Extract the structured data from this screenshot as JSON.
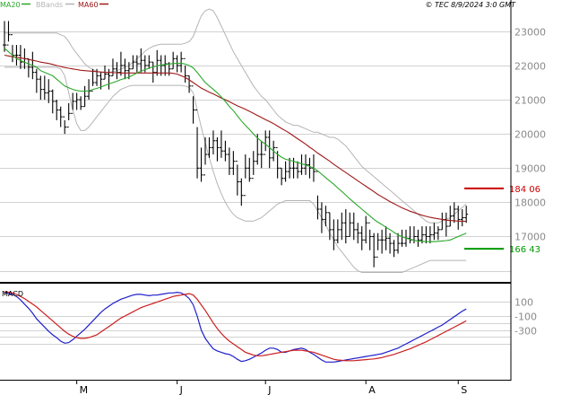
{
  "header": {
    "legend": [
      {
        "label": "MA20",
        "color": "#2aa82a"
      },
      {
        "label": "BBands",
        "color": "#b4b4b4"
      },
      {
        "label": "MA60",
        "color": "#a01818"
      }
    ],
    "copyright": "© TEC 8/9/2024 3:0 GMT"
  },
  "chart_data": [
    {
      "type": "ohlc",
      "panel": "price",
      "y_ticks": [
        23000,
        22000,
        21000,
        20000,
        19000,
        18000,
        17000
      ],
      "y_tick_labels": [
        "23000",
        "22000",
        "21000",
        "20000",
        "19000",
        "18000",
        "17000"
      ],
      "ylim": [
        15700,
        23600
      ],
      "x_count": 116,
      "x_tick_labels": [
        {
          "label": "M",
          "index": 18
        },
        {
          "label": "J",
          "index": 43
        },
        {
          "label": "J",
          "index": 65
        },
        {
          "label": "A",
          "index": 90
        },
        {
          "label": "S",
          "index": 113
        }
      ],
      "close": [
        22600,
        22900,
        22300,
        22300,
        22100,
        22200,
        21950,
        21800,
        21600,
        21300,
        21200,
        21250,
        20950,
        20700,
        20500,
        20200,
        20600,
        20950,
        21000,
        20800,
        21100,
        21250,
        21500,
        21700,
        21600,
        21750,
        21700,
        21900,
        21800,
        22000,
        21850,
        21900,
        22100,
        22050,
        22150,
        22000,
        22100,
        21800,
        22150,
        22000,
        22050,
        21900,
        22200,
        22000,
        22200,
        21700,
        21400,
        20700,
        19000,
        18800,
        19400,
        19600,
        19800,
        19600,
        19500,
        19400,
        19000,
        19200,
        18600,
        18200,
        19000,
        18700,
        19200,
        19400,
        19400,
        19900,
        19300,
        19600,
        19000,
        18700,
        18900,
        19000,
        19000,
        18900,
        19000,
        19100,
        19000,
        18900,
        17800,
        17500,
        17700,
        17200,
        16900,
        17200,
        17400,
        17000,
        17400,
        17200,
        17100,
        16900,
        17400,
        17000,
        16400,
        16900,
        16900,
        16950,
        16800,
        16600,
        16800,
        16800,
        16950,
        16900,
        17000,
        16900,
        17050,
        17000,
        17050,
        17100,
        17200,
        17500,
        17300,
        17600,
        17800,
        17500,
        17550,
        17650
      ],
      "high": [
        23300,
        23300,
        22600,
        22600,
        22600,
        22500,
        22200,
        22400,
        21900,
        21700,
        21700,
        21600,
        21300,
        21000,
        20800,
        20400,
        20900,
        21200,
        21200,
        21100,
        21400,
        21600,
        21900,
        21900,
        21800,
        22000,
        21900,
        22200,
        22100,
        22400,
        22200,
        22100,
        22300,
        22300,
        22500,
        22300,
        22300,
        22100,
        22450,
        22300,
        22300,
        22100,
        22400,
        22300,
        22400,
        22000,
        21700,
        21100,
        20200,
        19600,
        19900,
        19900,
        20100,
        19900,
        20100,
        19800,
        19600,
        19500,
        19100,
        18700,
        19400,
        19300,
        19500,
        20000,
        19800,
        20100,
        20100,
        19800,
        19500,
        19000,
        19200,
        19300,
        19300,
        19200,
        19400,
        19400,
        19300,
        19400,
        18200,
        18000,
        17900,
        17700,
        17500,
        17500,
        17700,
        17800,
        17700,
        17700,
        17400,
        17300,
        17600,
        17200,
        17100,
        17100,
        17200,
        17300,
        17100,
        16900,
        17100,
        17200,
        17200,
        17300,
        17300,
        17200,
        17300,
        17300,
        17300,
        17400,
        17300,
        17700,
        17700,
        17900,
        18000,
        17900,
        17800,
        17900
      ],
      "low": [
        22400,
        22700,
        22100,
        22000,
        21900,
        21900,
        21650,
        21600,
        21200,
        21000,
        21000,
        20900,
        20600,
        20400,
        20200,
        20000,
        20400,
        20700,
        20700,
        20700,
        20800,
        21000,
        21400,
        21400,
        21300,
        21600,
        21300,
        21700,
        21600,
        21700,
        21600,
        21600,
        21900,
        21800,
        21800,
        21800,
        21900,
        21500,
        21700,
        21700,
        21700,
        21700,
        21900,
        21800,
        21800,
        21500,
        21200,
        20300,
        18700,
        18600,
        19100,
        19300,
        19400,
        19200,
        19300,
        19200,
        18800,
        18800,
        18200,
        17900,
        18700,
        18600,
        18800,
        19100,
        19000,
        19500,
        19000,
        19200,
        18700,
        18500,
        18600,
        18700,
        18700,
        18700,
        18800,
        18800,
        18700,
        18600,
        17500,
        17100,
        17300,
        16900,
        16600,
        16800,
        16900,
        16800,
        17000,
        16900,
        16800,
        16600,
        16800,
        16600,
        16100,
        16600,
        16500,
        16600,
        16500,
        16400,
        16500,
        16700,
        16700,
        16800,
        16800,
        16700,
        16800,
        16800,
        16800,
        16900,
        16900,
        17200,
        17000,
        17300,
        17400,
        17200,
        17300,
        17400
      ],
      "ma20": [
        22500,
        22400,
        22300,
        22200,
        22150,
        22100,
        22050,
        22000,
        21950,
        21850,
        21800,
        21750,
        21700,
        21600,
        21500,
        21400,
        21350,
        21300,
        21270,
        21250,
        21250,
        21260,
        21300,
        21330,
        21370,
        21420,
        21460,
        21500,
        21540,
        21590,
        21620,
        21660,
        21720,
        21780,
        21830,
        21880,
        21920,
        21960,
        21990,
        22010,
        22030,
        22040,
        22060,
        22060,
        22070,
        22040,
        22000,
        21930,
        21800,
        21650,
        21500,
        21400,
        21300,
        21200,
        21080,
        20950,
        20800,
        20680,
        20530,
        20380,
        20250,
        20130,
        20000,
        19880,
        19780,
        19700,
        19600,
        19500,
        19400,
        19320,
        19260,
        19230,
        19200,
        19160,
        19130,
        19090,
        19050,
        19000,
        18920,
        18820,
        18720,
        18620,
        18530,
        18420,
        18320,
        18210,
        18100,
        18000,
        17900,
        17800,
        17700,
        17600,
        17500,
        17420,
        17350,
        17270,
        17200,
        17120,
        17050,
        16990,
        16950,
        16920,
        16890,
        16870,
        16860,
        16850,
        16850,
        16850,
        16860,
        16870,
        16880,
        16900,
        16950,
        17000,
        17050,
        17100
      ],
      "ma60": [
        22300,
        22280,
        22260,
        22240,
        22220,
        22200,
        22180,
        22150,
        22130,
        22100,
        22080,
        22060,
        22030,
        22000,
        21970,
        21940,
        21920,
        21900,
        21880,
        21860,
        21850,
        21840,
        21830,
        21820,
        21810,
        21800,
        21800,
        21790,
        21790,
        21780,
        21780,
        21780,
        21780,
        21780,
        21780,
        21780,
        21780,
        21780,
        21780,
        21780,
        21780,
        21780,
        21770,
        21750,
        21700,
        21650,
        21580,
        21500,
        21420,
        21340,
        21280,
        21220,
        21170,
        21110,
        21050,
        21000,
        20940,
        20880,
        20820,
        20770,
        20720,
        20660,
        20600,
        20540,
        20480,
        20420,
        20360,
        20300,
        20230,
        20160,
        20090,
        20020,
        19940,
        19860,
        19780,
        19700,
        19610,
        19530,
        19440,
        19360,
        19280,
        19200,
        19110,
        19030,
        18950,
        18870,
        18790,
        18710,
        18630,
        18550,
        18470,
        18390,
        18310,
        18230,
        18160,
        18090,
        18020,
        17960,
        17900,
        17840,
        17790,
        17740,
        17700,
        17660,
        17620,
        17590,
        17560,
        17540,
        17520,
        17500,
        17480,
        17470,
        17460,
        17450,
        17450,
        17440
      ],
      "bb_upper": [
        22950,
        22950,
        22950,
        22950,
        22950,
        22950,
        22950,
        22950,
        22950,
        22950,
        22950,
        22950,
        22950,
        22950,
        22900,
        22850,
        22700,
        22500,
        22350,
        22200,
        22050,
        21950,
        21880,
        21830,
        21800,
        21800,
        21800,
        21820,
        21850,
        21900,
        21950,
        22000,
        22100,
        22200,
        22300,
        22420,
        22500,
        22560,
        22600,
        22620,
        22620,
        22620,
        22620,
        22620,
        22620,
        22650,
        22700,
        22850,
        23150,
        23450,
        23600,
        23650,
        23600,
        23400,
        23150,
        22900,
        22650,
        22400,
        22200,
        22000,
        21800,
        21600,
        21400,
        21250,
        21100,
        21000,
        20850,
        20700,
        20550,
        20450,
        20350,
        20300,
        20250,
        20250,
        20200,
        20150,
        20100,
        20050,
        20050,
        20000,
        19950,
        19900,
        19900,
        19850,
        19750,
        19650,
        19500,
        19350,
        19200,
        19050,
        18950,
        18850,
        18750,
        18650,
        18550,
        18450,
        18350,
        18250,
        18150,
        18050,
        17950,
        17850,
        17750,
        17650,
        17550,
        17450,
        17400,
        17400,
        17400,
        17450,
        17500,
        17550,
        17650,
        17750,
        17850,
        17950
      ],
      "bb_lower": [
        21950,
        21950,
        21950,
        21950,
        21950,
        21950,
        21950,
        21950,
        21950,
        21950,
        21950,
        21950,
        21950,
        21950,
        21900,
        21700,
        21200,
        20700,
        20300,
        20100,
        20100,
        20200,
        20350,
        20500,
        20650,
        20800,
        20950,
        21100,
        21200,
        21300,
        21350,
        21400,
        21420,
        21420,
        21420,
        21420,
        21420,
        21420,
        21420,
        21420,
        21420,
        21420,
        21420,
        21420,
        21420,
        21400,
        21350,
        21200,
        20700,
        20200,
        19750,
        19300,
        18900,
        18550,
        18250,
        18000,
        17800,
        17650,
        17550,
        17500,
        17450,
        17450,
        17450,
        17500,
        17550,
        17650,
        17750,
        17850,
        17950,
        18000,
        18050,
        18050,
        18050,
        18050,
        18050,
        18050,
        18050,
        17950,
        17750,
        17550,
        17350,
        17100,
        16900,
        16700,
        16550,
        16400,
        16250,
        16100,
        16000,
        15950,
        15950,
        15950,
        15950,
        15950,
        15950,
        15950,
        15950,
        15950,
        15950,
        15950,
        16000,
        16050,
        16100,
        16150,
        16200,
        16250,
        16300,
        16300,
        16300,
        16300,
        16300,
        16300,
        16300,
        16300,
        16300,
        16300
      ],
      "levels": [
        {
          "value": 18406,
          "label": "184 06",
          "color": "#cc0000"
        },
        {
          "value": 16643,
          "label": "166 43",
          "color": "#009900"
        }
      ]
    },
    {
      "type": "line",
      "panel": "MACD",
      "title": "MACD",
      "y_ticks": [
        100,
        -100,
        -300
      ],
      "y_tick_labels": [
        "100",
        "-100",
        "-300"
      ],
      "ylim": [
        -1000,
        350
      ],
      "series": [
        {
          "color": "#1f1fcc",
          "values": [
            236,
            220,
            210,
            180,
            130,
            70,
            10,
            -60,
            -140,
            -200,
            -260,
            -320,
            -370,
            -410,
            -460,
            -490,
            -480,
            -440,
            -390,
            -340,
            -290,
            -230,
            -170,
            -110,
            -50,
            0,
            40,
            80,
            110,
            140,
            160,
            180,
            200,
            210,
            210,
            200,
            190,
            200,
            200,
            210,
            220,
            230,
            230,
            240,
            230,
            200,
            150,
            60,
            -100,
            -300,
            -420,
            -500,
            -570,
            -600,
            -620,
            -640,
            -650,
            -680,
            -720,
            -750,
            -740,
            -720,
            -690,
            -660,
            -630,
            -590,
            -560,
            -560,
            -580,
            -620,
            -620,
            -600,
            -580,
            -570,
            -560,
            -580,
            -620,
            -650,
            -690,
            -730,
            -760,
            -760,
            -760,
            -750,
            -740,
            -730,
            -720,
            -710,
            -700,
            -690,
            -680,
            -670,
            -660,
            -650,
            -640,
            -620,
            -600,
            -580,
            -560,
            -530,
            -500,
            -470,
            -440,
            -410,
            -380,
            -350,
            -320,
            -290,
            -260,
            -230,
            -190,
            -150,
            -110,
            -70,
            -30,
            0
          ]
        },
        {
          "color": "#cc1f1f",
          "values": [
            250,
            240,
            230,
            210,
            180,
            150,
            110,
            70,
            30,
            -20,
            -70,
            -120,
            -170,
            -220,
            -270,
            -320,
            -360,
            -390,
            -410,
            -420,
            -420,
            -410,
            -390,
            -370,
            -330,
            -290,
            -250,
            -210,
            -170,
            -130,
            -100,
            -70,
            -40,
            -10,
            20,
            40,
            60,
            80,
            100,
            120,
            140,
            160,
            180,
            190,
            200,
            210,
            220,
            200,
            140,
            60,
            -20,
            -110,
            -200,
            -280,
            -350,
            -410,
            -460,
            -500,
            -540,
            -580,
            -620,
            -640,
            -660,
            -670,
            -670,
            -660,
            -650,
            -640,
            -630,
            -620,
            -610,
            -600,
            -590,
            -590,
            -590,
            -600,
            -610,
            -620,
            -640,
            -660,
            -680,
            -700,
            -720,
            -730,
            -735,
            -740,
            -740,
            -740,
            -735,
            -730,
            -725,
            -720,
            -715,
            -705,
            -695,
            -680,
            -665,
            -650,
            -630,
            -610,
            -590,
            -570,
            -545,
            -520,
            -495,
            -470,
            -440,
            -410,
            -380,
            -350,
            -320,
            -290,
            -260,
            -230,
            -200,
            -170
          ]
        }
      ]
    }
  ]
}
